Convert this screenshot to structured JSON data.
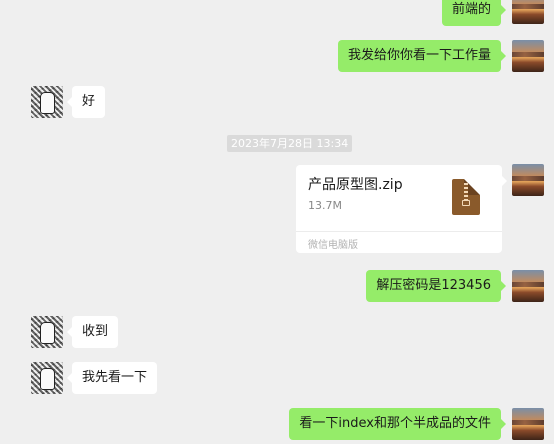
{
  "chat": {
    "messages": [
      {
        "side": "right",
        "text": "前端的"
      },
      {
        "side": "right",
        "text": "我发给你你看一下工作量"
      },
      {
        "side": "left",
        "text": "好"
      },
      {
        "side": "right",
        "text": "解压密码是123456"
      },
      {
        "side": "left",
        "text": "收到"
      },
      {
        "side": "left",
        "text": "我先看一下"
      },
      {
        "side": "right",
        "text": "看一下index和那个半成品的文件"
      }
    ],
    "timestamp": "2023年7月28日 13:34",
    "file": {
      "name": "产品原型图.zip",
      "size": "13.7M",
      "source": "微信电脑版",
      "icon": "zip-file-icon"
    }
  },
  "colors": {
    "background": "#efefef",
    "self_bubble": "#95ec69",
    "other_bubble": "#ffffff",
    "timestamp_bg": "#dadada"
  },
  "avatars": {
    "self": "sunset-landscape-avatar",
    "other": "manga-illustration-avatar"
  }
}
